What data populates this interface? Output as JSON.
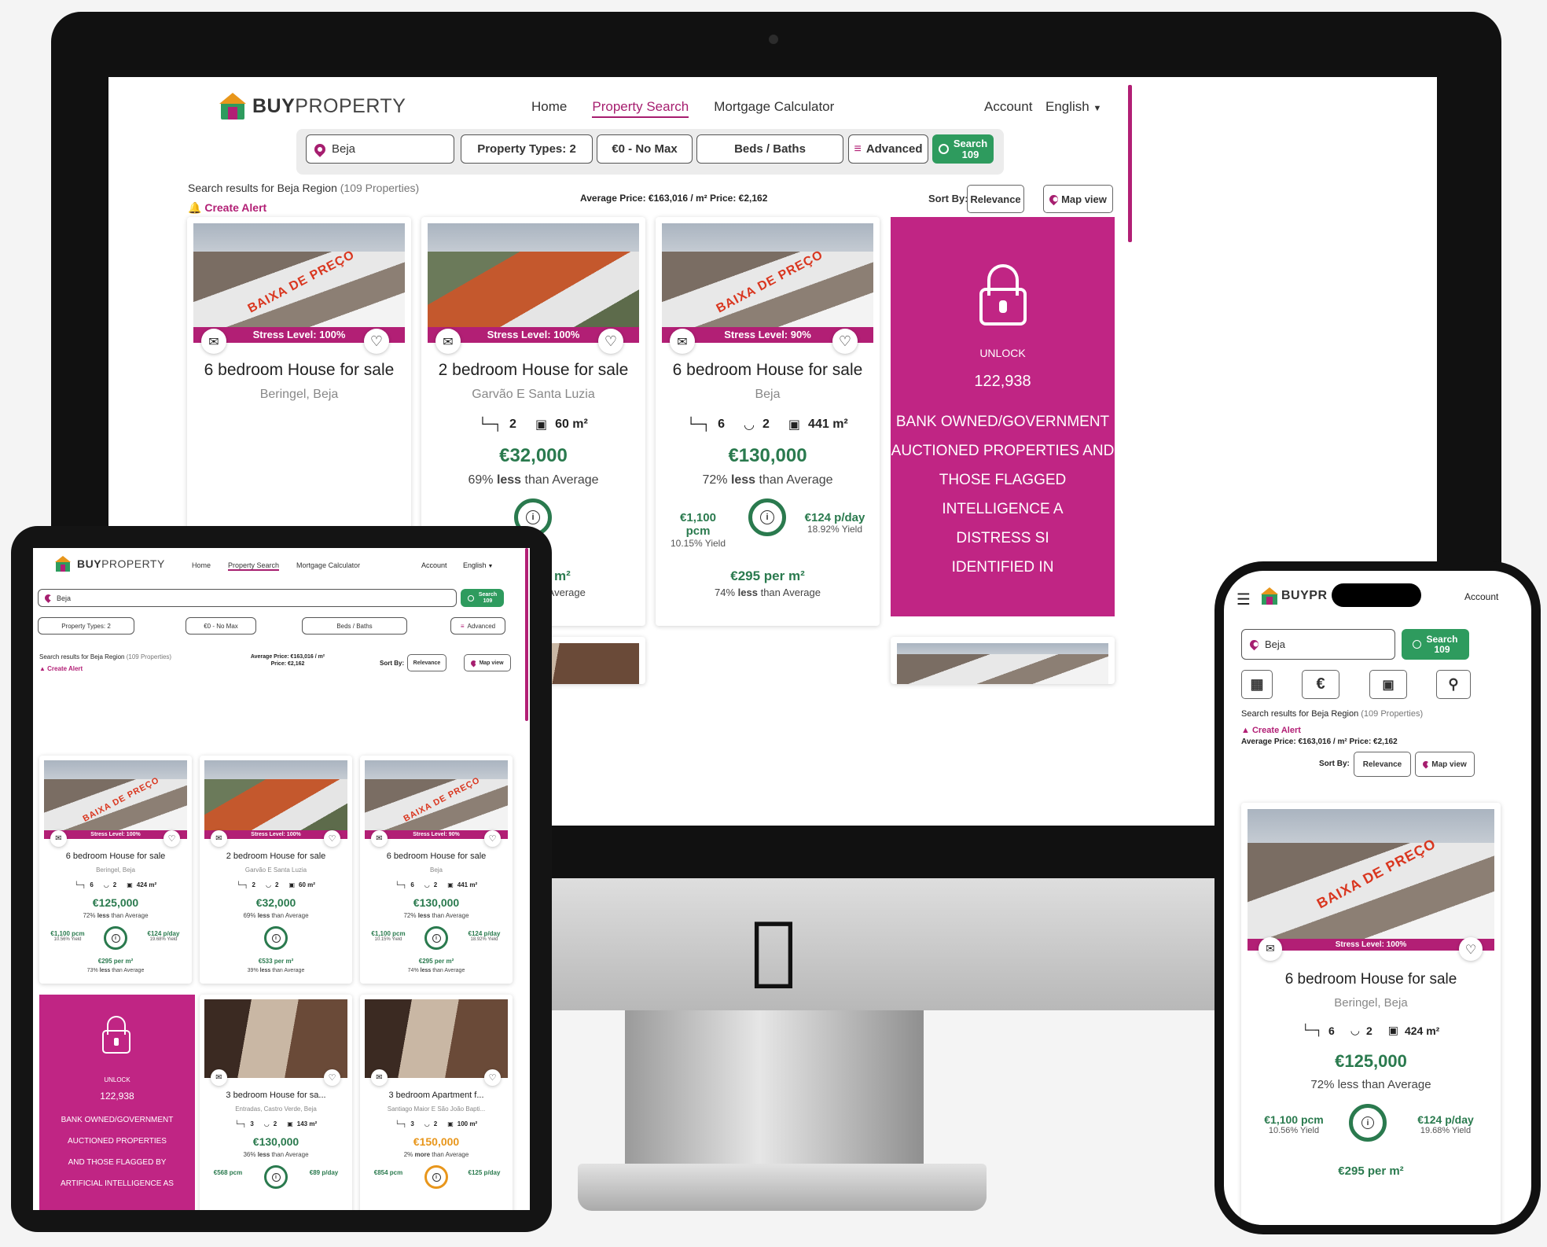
{
  "brand": {
    "logo_bold": "BUY",
    "logo_light": "PROPERTY",
    "logo_short": "BUYPR"
  },
  "nav": {
    "home": "Home",
    "property_search": "Property Search",
    "mortgage": "Mortgage Calculator",
    "account": "Account",
    "language": "English"
  },
  "search": {
    "location": "Beja",
    "property_types": "Property Types: 2",
    "price": "€0 - No Max",
    "beds_baths": "Beds / Baths",
    "advanced": "Advanced",
    "search_label": "Search",
    "search_count": "109"
  },
  "results": {
    "summary_prefix": "Search results for Beja Region",
    "summary_count": "(109 Properties)",
    "create_alert": "Create Alert",
    "average": "Average Price: €163,016 / m² Price: €2,162",
    "average_line1": "Average Price: €163,016 / m²",
    "average_line2": "Price: €2,162",
    "sort_by": "Sort By:",
    "sort_value": "Relevance",
    "map_view": "Map view"
  },
  "listings": [
    {
      "title": "6 bedroom House for sale",
      "location": "Beringel, Beja",
      "stress": "Stress Level: 100%",
      "stamp": "BAIXA DE PREÇO",
      "beds": "6",
      "baths": "2",
      "area": "424 m²",
      "price": "€125,000",
      "avg_pct": "72%",
      "avg_word": "less",
      "avg_tail": "than Average",
      "rent": "€1,100 pcm",
      "rent_yield": "10.56% Yield",
      "day": "€124 p/day",
      "day_yield": "19.68% Yield",
      "ppm": "€295 per m²",
      "ppm_pct": "73%",
      "ppm_word": "less",
      "ppm_tail": "than Average"
    },
    {
      "title": "2 bedroom House for sale",
      "location": "Garvão E Santa Luzia",
      "stress": "Stress Level: 100%",
      "stamp": "",
      "beds": "2",
      "baths": "2",
      "area": "60 m²",
      "price": "€32,000",
      "avg_pct": "69%",
      "avg_word": "less",
      "avg_tail": "than Average",
      "rent": "",
      "rent_yield": "",
      "day": "",
      "day_yield": "",
      "ppm": "€533 per m²",
      "ppm_pct": "39%",
      "ppm_word": "less",
      "ppm_tail": "than Average"
    },
    {
      "title": "6 bedroom House for sale",
      "location": "Beja",
      "stress": "Stress Level: 90%",
      "stamp": "BAIXA DE PREÇO",
      "beds": "6",
      "baths": "2",
      "area": "441 m²",
      "price": "€130,000",
      "avg_pct": "72%",
      "avg_word": "less",
      "avg_tail": "than Average",
      "rent": "€1,100 pcm",
      "rent_yield": "10.15% Yield",
      "day": "€124 p/day",
      "day_yield": "18.92% Yield",
      "ppm": "€295 per m²",
      "ppm_pct": "74%",
      "ppm_word": "less",
      "ppm_tail": "than Average"
    },
    {
      "title": "3 bedroom House for sa...",
      "location": "Entradas, Castro Verde, Beja",
      "stress": "",
      "stamp": "",
      "beds": "3",
      "baths": "2",
      "area": "143 m²",
      "price": "€130,000",
      "avg_pct": "36%",
      "avg_word": "less",
      "avg_tail": "than Average",
      "rent": "€568 pcm",
      "day": "€89 p/day"
    },
    {
      "title": "3 bedroom Apartment f...",
      "location": "Santiago Maior E São João Bapti...",
      "stress": "",
      "stamp": "",
      "beds": "3",
      "baths": "2",
      "area": "100 m²",
      "price": "€150,000",
      "avg_pct": "2%",
      "avg_word": "more",
      "avg_tail": "than Average",
      "rent": "€854 pcm",
      "day": "€125 p/day"
    }
  ],
  "desktop_overrides": {
    "card1_location": "Beringel, Beja",
    "card3_rent_yield": "10.15% Yield",
    "card3_ppm_pct": "74%",
    "card2_avg": "39% less than Average"
  },
  "phone_listing": {
    "title": "6 bedroom House for sale",
    "location": "Beringel, Beja",
    "stress": "Stress Level: 100%",
    "beds": "6",
    "baths": "2",
    "area": "424 m²",
    "price": "€125,000",
    "avg": "72% less than Average",
    "rent": "€1,100 pcm",
    "rent_yield": "10.56% Yield",
    "day": "€124 p/day",
    "day_yield": "19.68% Yield",
    "ppm": "€295 per m²"
  },
  "unlock": {
    "label": "UNLOCK",
    "count": "122,938",
    "desktop_lines": [
      "BANK OWNED/GOVERNMENT",
      "AUCTIONED PROPERTIES AND",
      "THOSE FLAGGED",
      "INTELLIGENCE A",
      "DISTRESS SI",
      "IDENTIFIED IN"
    ],
    "tablet_lines": [
      "BANK OWNED/GOVERNMENT",
      "AUCTIONED PROPERTIES",
      "AND THOSE FLAGGED BY",
      "ARTIFICIAL INTELLIGENCE AS"
    ]
  },
  "colors": {
    "brand_magenta": "#b21f75",
    "unlock_bg": "#c02584",
    "price_green": "#2a7a4e",
    "search_green": "#2e9b5e",
    "price_orange": "#e8961b"
  },
  "icons": [
    "map-pin-icon",
    "search-icon",
    "sliders-icon",
    "bell-icon",
    "mail-icon",
    "heart-icon",
    "bed-icon",
    "bath-icon",
    "area-icon",
    "info-icon",
    "padlock-icon",
    "apple-logo-icon",
    "hamburger-menu-icon",
    "building-icon",
    "euro-icon",
    "bed-filter-icon",
    "magnify-filter-icon"
  ]
}
